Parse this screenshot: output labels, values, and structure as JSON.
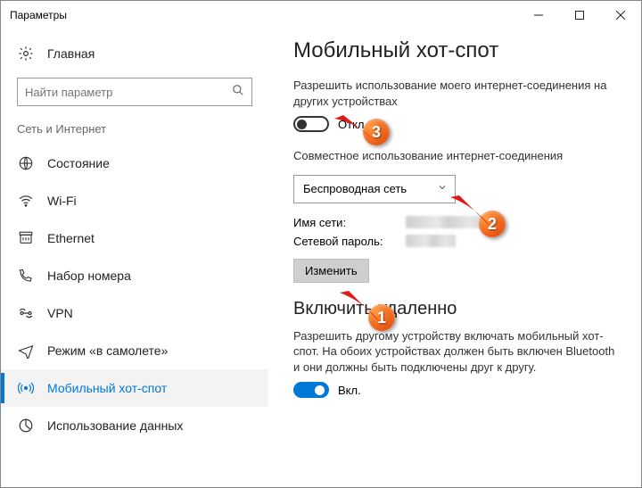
{
  "window": {
    "title": "Параметры"
  },
  "sidebar": {
    "home": "Главная",
    "search_placeholder": "Найти параметр",
    "section": "Сеть и Интернет",
    "items": [
      {
        "label": "Состояние",
        "icon": "globe-icon"
      },
      {
        "label": "Wi-Fi",
        "icon": "wifi-icon"
      },
      {
        "label": "Ethernet",
        "icon": "ethernet-icon"
      },
      {
        "label": "Набор номера",
        "icon": "dialup-icon"
      },
      {
        "label": "VPN",
        "icon": "vpn-icon"
      },
      {
        "label": "Режим «в самолете»",
        "icon": "airplane-icon"
      },
      {
        "label": "Мобильный хот-спот",
        "icon": "hotspot-icon"
      },
      {
        "label": "Использование данных",
        "icon": "datausage-icon"
      }
    ]
  },
  "main": {
    "heading": "Мобильный хот-спот",
    "share_desc": "Разрешить использование моего интернет-соединения на других устройствах",
    "share_toggle_state": "Откл.",
    "share_from_label": "Совместное использование интернет-соединения",
    "combo_value": "Беспроводная сеть",
    "net_name_label": "Имя сети:",
    "net_pass_label": "Сетевой пароль:",
    "edit_button": "Изменить",
    "remote_heading": "Включить удаленно",
    "remote_desc": "Разрешить другому устройству включать мобильный хот-спот. На обоих устройствах должен быть включен Bluetooth и они должны быть подключены друг к другу.",
    "remote_toggle_state": "Вкл."
  },
  "annotations": {
    "m1": "1",
    "m2": "2",
    "m3": "3"
  }
}
